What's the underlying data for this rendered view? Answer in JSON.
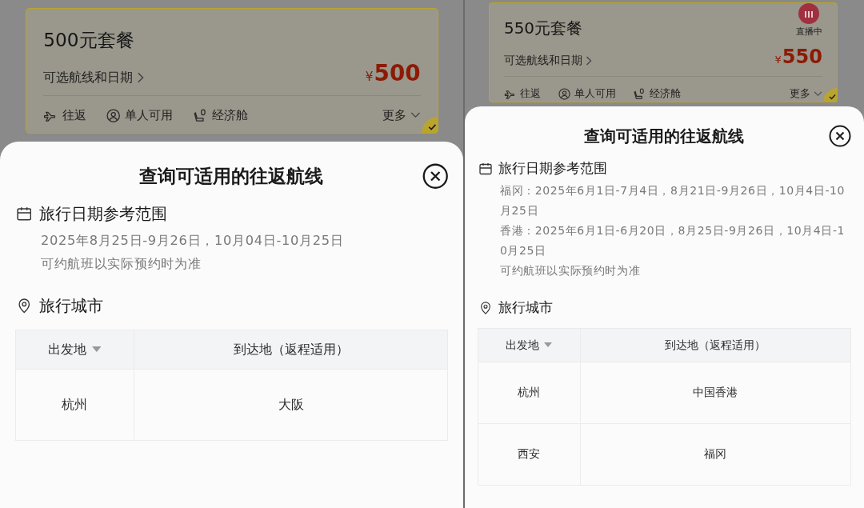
{
  "panels": [
    {
      "card": {
        "title": "500元套餐",
        "subtitle": "可选航线和日期",
        "currency": "¥",
        "price": "500",
        "tags": [
          {
            "kind": "plane",
            "label": "往返"
          },
          {
            "kind": "person",
            "label": "单人可用"
          },
          {
            "kind": "seat",
            "label": "经济舱"
          }
        ],
        "more": "更多",
        "selected": true
      },
      "sheet": {
        "title": "查询可适用的往返航线",
        "date_heading": "旅行日期参考范围",
        "date_lines": [
          "2025年8月25日-9月26日，10月04日-10月25日"
        ],
        "note": "可约航班以实际预约时为准",
        "city_heading": "旅行城市",
        "columns": [
          "出发地",
          "到达地（返程适用）"
        ],
        "rows": [
          [
            "杭州",
            "大阪"
          ]
        ]
      }
    },
    {
      "card": {
        "title": "550元套餐",
        "subtitle": "可选航线和日期",
        "currency": "¥",
        "price": "550",
        "live": "直播中",
        "tags": [
          {
            "kind": "plane",
            "label": "往返"
          },
          {
            "kind": "person",
            "label": "单人可用"
          },
          {
            "kind": "seat",
            "label": "经济舱"
          }
        ],
        "more": "更多",
        "selected": true
      },
      "sheet": {
        "title": "查询可适用的往返航线",
        "date_heading": "旅行日期参考范围",
        "date_lines": [
          "福冈：2025年6月1日-7月4日，8月21日-9月26日，10月4日-10月25日",
          "香港：2025年6月1日-6月20日，8月25日-9月26日，10月4日-10月25日"
        ],
        "note": "可约航班以实际预约时为准",
        "city_heading": "旅行城市",
        "columns": [
          "出发地",
          "到达地（返程适用）"
        ],
        "rows": [
          [
            "杭州",
            "中国香港"
          ],
          [
            "西安",
            "福冈"
          ]
        ]
      }
    }
  ]
}
